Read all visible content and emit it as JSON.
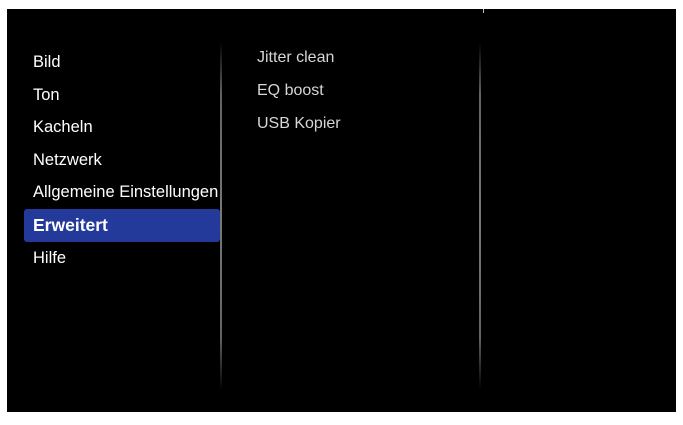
{
  "menu": {
    "items": [
      {
        "label": "Bild"
      },
      {
        "label": "Ton"
      },
      {
        "label": "Kacheln"
      },
      {
        "label": "Netzwerk"
      },
      {
        "label": "Allgemeine Einstellungen"
      },
      {
        "label": "Erweitert",
        "selected": true
      },
      {
        "label": "Hilfe"
      }
    ]
  },
  "submenu": {
    "items": [
      {
        "label": "Jitter clean"
      },
      {
        "label": "EQ boost"
      },
      {
        "label": "USB Kopier"
      }
    ]
  },
  "colors": {
    "background": "#000000",
    "selected_highlight": "#233a9b",
    "text_primary": "#ffffff",
    "text_secondary": "#d6d6d6"
  }
}
